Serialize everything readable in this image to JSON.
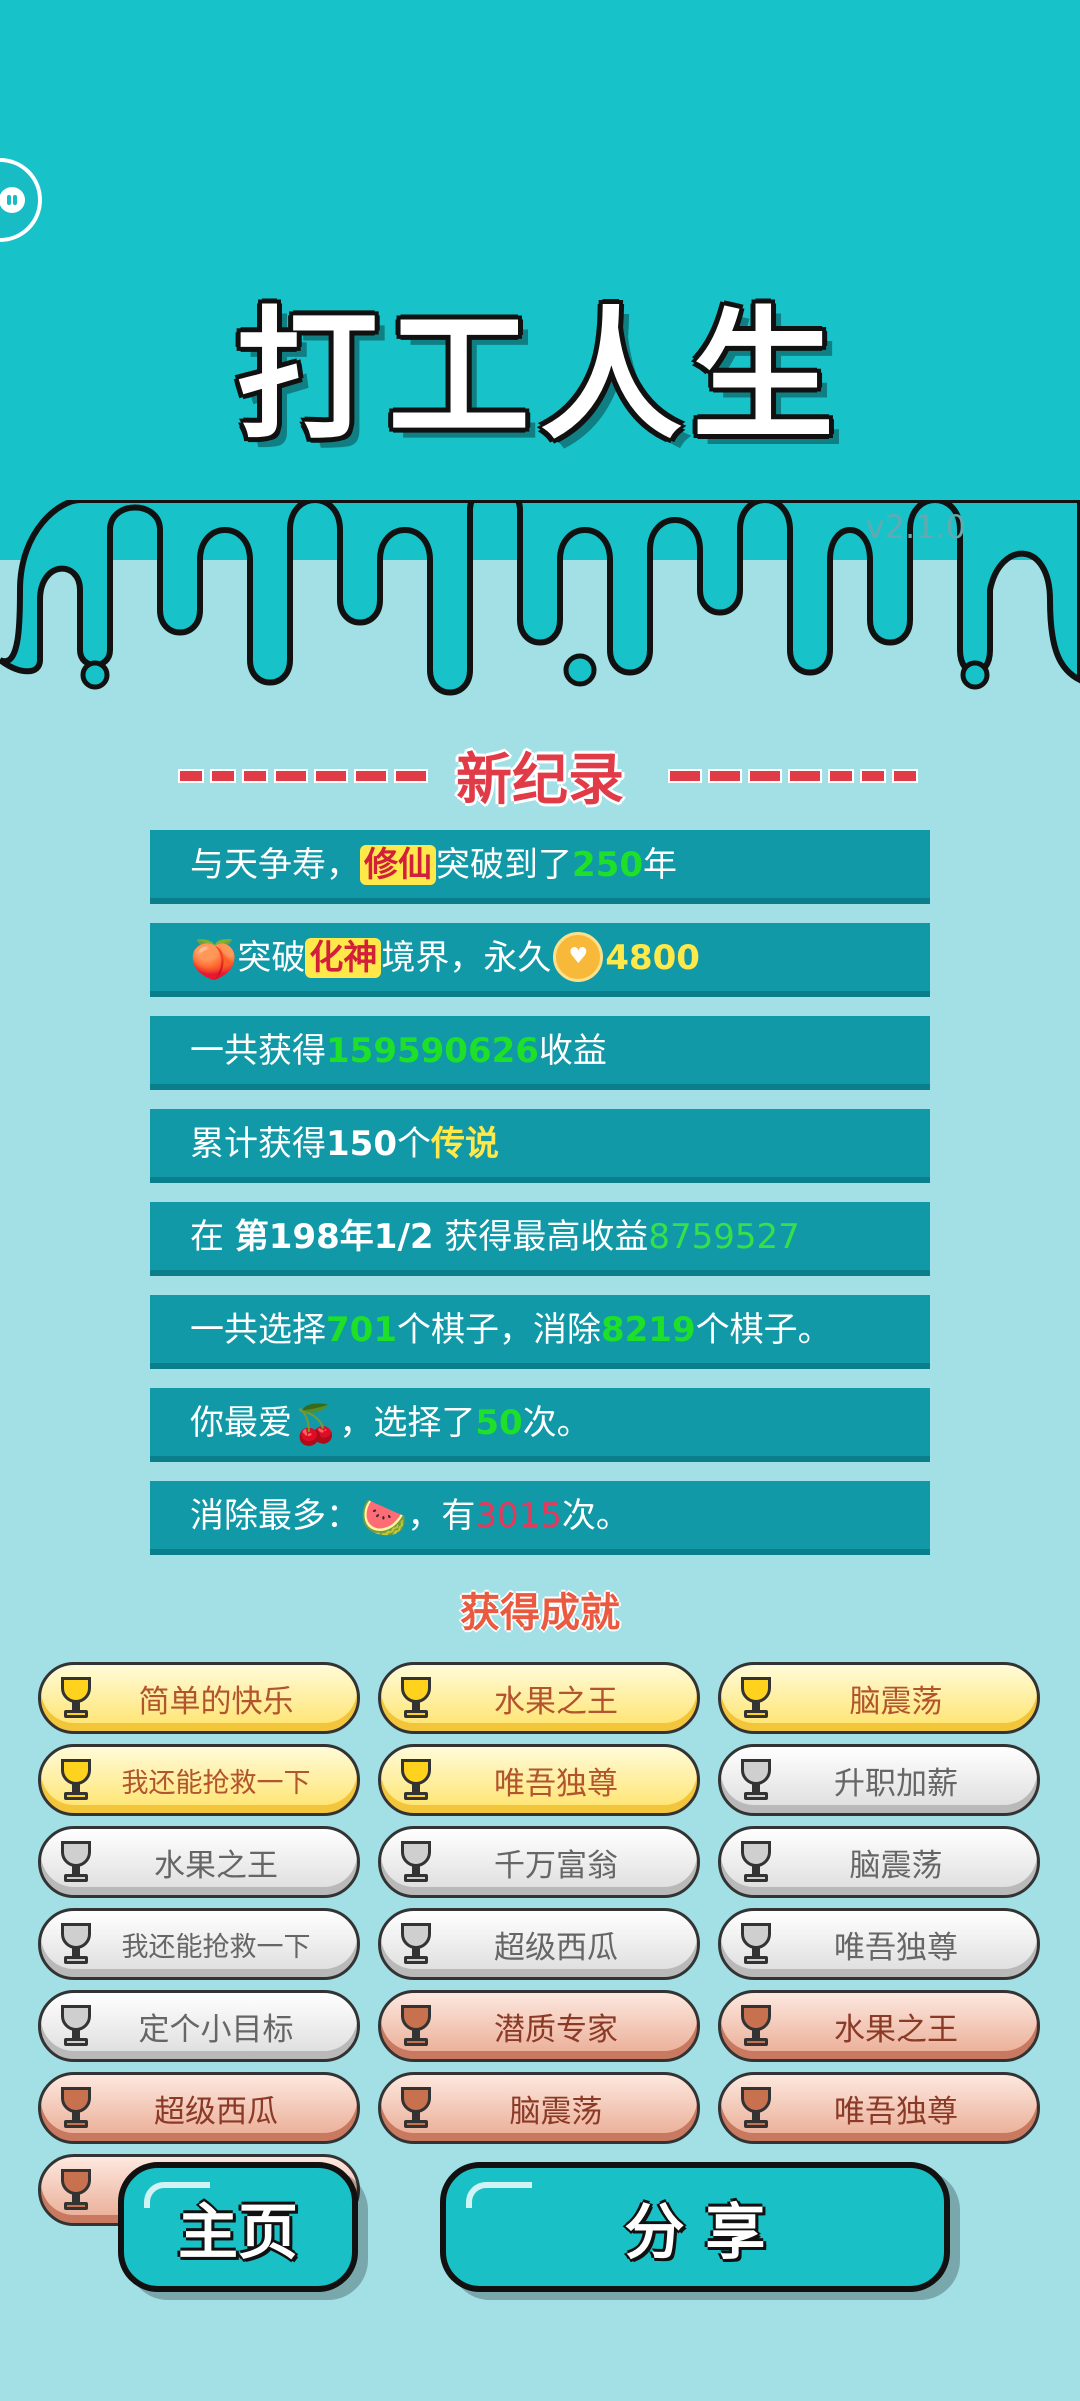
{
  "header": {
    "title": "打工人生",
    "version": "v2.1.0"
  },
  "record": {
    "title": "新纪录",
    "rows": [
      {
        "p1": "与天争寿，",
        "hl": "修仙",
        "p2": "突破到了",
        "num": "250",
        "p3": "年"
      },
      {
        "p1": "突破",
        "hl": "化神",
        "p2": "境界，永久",
        "num": "4800"
      },
      {
        "p1": "一共获得",
        "num": "159590626",
        "p2": "收益"
      },
      {
        "p1": "累计获得",
        "num": "150",
        "p2": "个",
        "hl": "传说"
      },
      {
        "p1": "在",
        "bold": "第198年1/2",
        "p2": "获得最高收益",
        "num": "8759527"
      },
      {
        "p1": "一共选择",
        "num": "701",
        "p2": "个棋子，消除",
        "num2": "8219",
        "p3": "个棋子。"
      },
      {
        "p1": "你最爱",
        "p2": "，选择了",
        "num": "50",
        "p3": "次。"
      },
      {
        "p1": "消除最多：",
        "p2": "，有",
        "num": "3015",
        "p3": "次。"
      }
    ],
    "icons": {
      "peach": "peach-icon",
      "coin": "heart-coin-icon",
      "cherry": "cherry-icon",
      "watermelon": "watermelon-icon"
    }
  },
  "achievements": {
    "title": "获得成就",
    "items": [
      {
        "label": "简单的快乐",
        "tier": "gold"
      },
      {
        "label": "水果之王",
        "tier": "gold"
      },
      {
        "label": "脑震荡",
        "tier": "gold"
      },
      {
        "label": "我还能抢救一下",
        "tier": "gold"
      },
      {
        "label": "唯吾独尊",
        "tier": "gold"
      },
      {
        "label": "升职加薪",
        "tier": "silver"
      },
      {
        "label": "水果之王",
        "tier": "silver"
      },
      {
        "label": "千万富翁",
        "tier": "silver"
      },
      {
        "label": "脑震荡",
        "tier": "silver"
      },
      {
        "label": "我还能抢救一下",
        "tier": "silver"
      },
      {
        "label": "超级西瓜",
        "tier": "silver"
      },
      {
        "label": "唯吾独尊",
        "tier": "silver"
      },
      {
        "label": "定个小目标",
        "tier": "silver"
      },
      {
        "label": "潜质专家",
        "tier": "bronze"
      },
      {
        "label": "水果之王",
        "tier": "bronze"
      },
      {
        "label": "超级西瓜",
        "tier": "bronze"
      },
      {
        "label": "脑震荡",
        "tier": "bronze"
      },
      {
        "label": "唯吾独尊",
        "tier": "bronze"
      },
      {
        "label": "",
        "tier": "bronze"
      }
    ]
  },
  "buttons": {
    "home": "主页",
    "share": "分 享"
  },
  "colors": {
    "teal_top": "#17c3c9",
    "teal_light": "#a2e0e6",
    "row_bg": "#1199a8",
    "accent_red": "#e23b48",
    "number_green": "#1ee028"
  }
}
